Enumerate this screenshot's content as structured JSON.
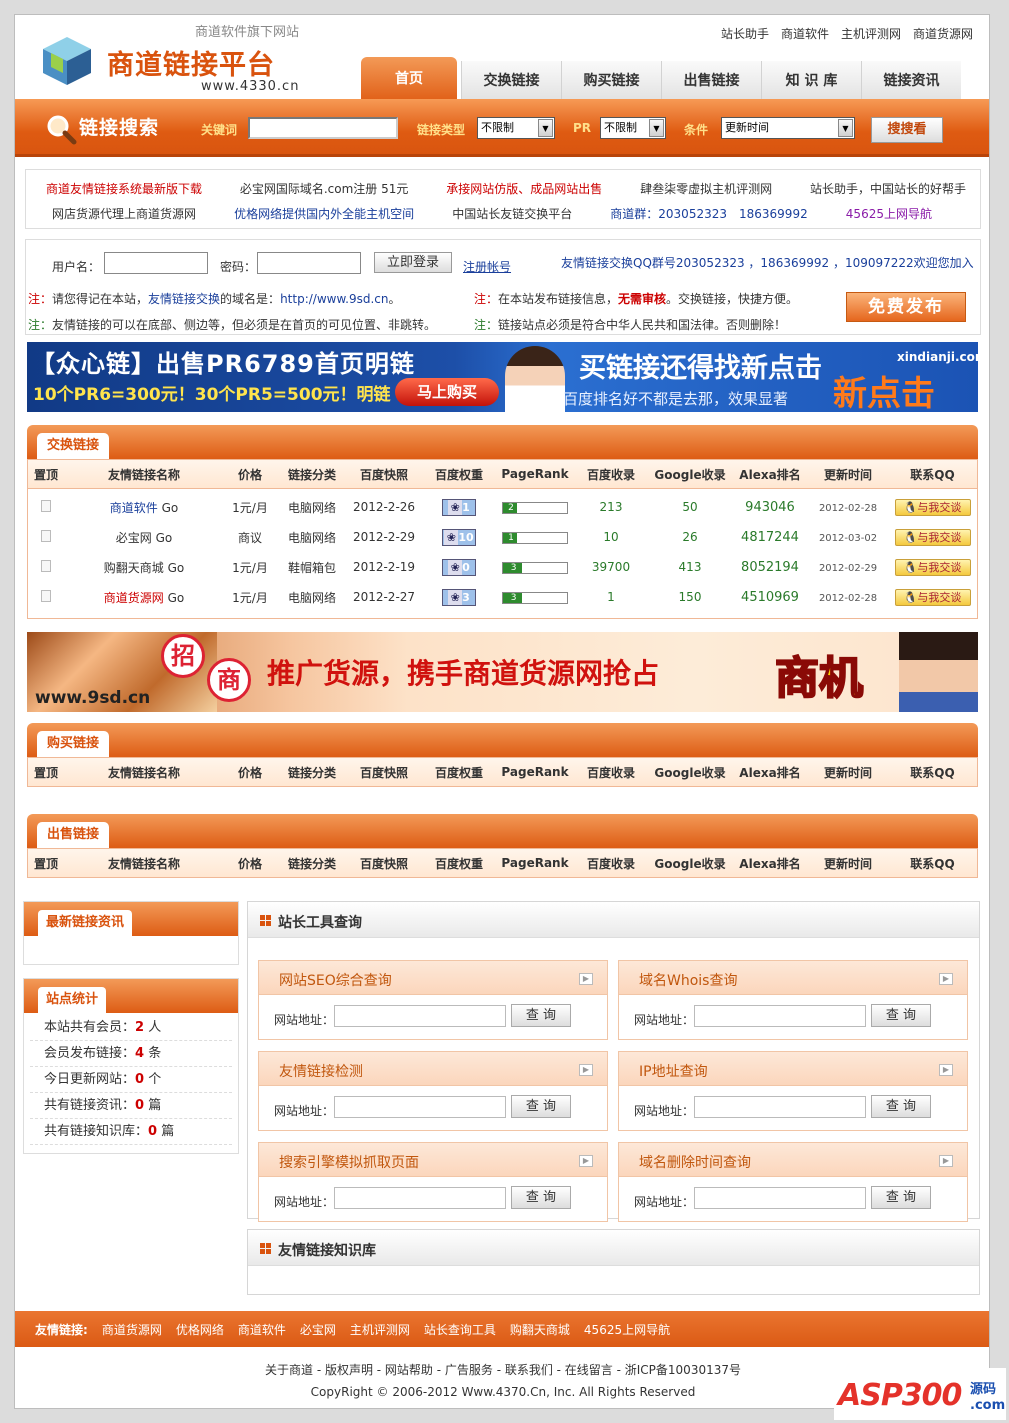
{
  "header": {
    "tagline": "商道软件旗下网站",
    "logo_title": "商道链接平台",
    "logo_url": "www.4330.cn",
    "toplinks": [
      "站长助手",
      "商道软件",
      "主机评测网",
      "商道货源网"
    ],
    "nav": [
      "首页",
      "交换链接",
      "购买链接",
      "出售链接",
      "知 识 库",
      "链接资讯"
    ]
  },
  "search": {
    "title": "链接搜索",
    "keyword_label": "关键词",
    "type_label": "链接类型",
    "type_value": "不限制",
    "pr_label": "PR",
    "pr_value": "不限制",
    "cond_label": "条件",
    "cond_value": "更新时间",
    "button": "搜搜看"
  },
  "ads": {
    "row1": [
      {
        "t": "商道友情链接系统最新版下载",
        "c": "#c00"
      },
      {
        "t": "必宝网国际域名.com注册 51元",
        "c": "#333"
      },
      {
        "t": "承接网站仿版、成品网站出售",
        "c": "#c00"
      },
      {
        "t": "肆叁柒零虚拟主机评测网",
        "c": "#333"
      },
      {
        "t": "站长助手，中国站长的好帮手",
        "c": "#333"
      }
    ],
    "row2": [
      {
        "t": "网店货源代理上商道货源网",
        "c": "#333"
      },
      {
        "t": "优格网络提供国内外全能主机空间",
        "c": "#1a3f9b"
      },
      {
        "t": "中国站长友链交换平台",
        "c": "#333"
      },
      {
        "t": "商道群：203052323　186369992",
        "c": "#1a3f9b"
      },
      {
        "t": "45625上网导航",
        "c": "#8a1ba8"
      }
    ]
  },
  "login": {
    "user_label": "用户名：",
    "pass_label": "密码：",
    "login_btn": "立即登录",
    "register": "注册帐号",
    "qq_groups": "友情链接交换QQ群号203052323 ，186369992 ，109097222欢迎您加入",
    "note1a": "注：",
    "note1b": "请您得记在本站，",
    "note1c": "友情链接交换",
    "note1d": "的域名是：",
    "note1e": "http://www.9sd.cn",
    "note1f": "。",
    "note2a": "注：",
    "note2b": "在本站发布链接信息，",
    "note2c": "无需审核",
    "note2d": "。交换链接，快捷方便。",
    "note3a": "注：",
    "note3b": "友情链接的可以在底部、侧边等，但必须是在首页的可见位置、非跳转。",
    "note4a": "注：",
    "note4b": "链接站点必须是符合中华人民共和国法律。否则删除！",
    "free_btn": "免费发布"
  },
  "banner1": {
    "left_title": "【众心链】出售PR6789首页明链",
    "left_sub": "10个PR6=300元！30个PR5=500元！明链",
    "buy_btn": "马上购买",
    "right_title": "买链接还得找新点击",
    "right_sub": "百度排名好不都是去那，效果显著",
    "right_site": "xindianji.com",
    "right_brand": "新点击"
  },
  "banner2": {
    "site": "www.9sd.cn",
    "zhao": "招",
    "shang": "商",
    "slogan1": "推广货源，携手商道货源网抢占",
    "slogan2": "商机"
  },
  "table_headers": [
    "置顶",
    "友情链接名称",
    "价格",
    "链接分类",
    "百度快照",
    "百度权重",
    "PageRank",
    "百度收录",
    "Google收录",
    "Alexa排名",
    "更新时间",
    "联系QQ"
  ],
  "exchange": {
    "title": "交换链接",
    "rows": [
      {
        "name": "商道软件",
        "go": "Go",
        "color": "#1a3f9b",
        "price": "1元/月",
        "cat": "电脑网络",
        "snap": "2012-2-26",
        "bw": "1",
        "pr": "2",
        "prpct": 0.2,
        "bd": "213",
        "gg": "50",
        "alexa": "943046",
        "upd": "2012-02-28",
        "qq": "与我交谈"
      },
      {
        "name": "必宝网",
        "go": "Go",
        "color": "#333",
        "price": "商议",
        "cat": "电脑网络",
        "snap": "2012-2-29",
        "bw": "10",
        "pr": "1",
        "prpct": 0.1,
        "bd": "10",
        "gg": "26",
        "alexa": "4817244",
        "upd": "2012-03-02",
        "qq": "与我交谈"
      },
      {
        "name": "购翻天商城",
        "go": "Go",
        "color": "#333",
        "price": "1元/月",
        "cat": "鞋帽箱包",
        "snap": "2012-2-19",
        "bw": "0",
        "pr": "3",
        "prpct": 0.3,
        "bd": "39700",
        "gg": "413",
        "alexa": "8052194",
        "upd": "2012-02-29",
        "qq": "与我交谈"
      },
      {
        "name": "商道货源网",
        "go": "Go",
        "color": "#c00",
        "price": "1元/月",
        "cat": "电脑网络",
        "snap": "2012-2-27",
        "bw": "3",
        "pr": "3",
        "prpct": 0.3,
        "bd": "1",
        "gg": "150",
        "alexa": "4510969",
        "upd": "2012-02-28",
        "qq": "与我交谈"
      }
    ]
  },
  "buy": {
    "title": "购买链接"
  },
  "sell": {
    "title": "出售链接"
  },
  "sidebar": {
    "news_title": "最新链接资讯",
    "stats_title": "站点统计",
    "stats": [
      {
        "l": "本站共有会员：",
        "v": "2",
        "u": " 人"
      },
      {
        "l": "会员发布链接：",
        "v": "4",
        "u": " 条"
      },
      {
        "l": "今日更新网站：",
        "v": "0",
        "u": " 个"
      },
      {
        "l": "共有链接资讯：",
        "v": "0",
        "u": " 篇"
      },
      {
        "l": "共有链接知识库：",
        "v": "0",
        "u": " 篇"
      }
    ]
  },
  "tools": {
    "title": "站长工具查询",
    "url_label": "网站地址：",
    "query": "查 询",
    "items": [
      "网站SEO综合查询",
      "域名Whois查询",
      "友情链接检测",
      "IP地址查询",
      "搜索引擎模拟抓取页面",
      "域名删除时间查询"
    ]
  },
  "kb": {
    "title": "友情链接知识库"
  },
  "footer": {
    "label": "友情链接:",
    "links": [
      "商道货源网",
      "优格网络",
      "商道软件",
      "必宝网",
      "主机评测网",
      "站长查询工具",
      "购翻天商城",
      "45625上网导航"
    ],
    "bottom_links": "关于商道 - 版权声明 - 网站帮助 - 广告服务 - 联系我们 - 在线留言 - 浙ICP备10030137号",
    "copyright": "CopyRight © 2006-2012 Www.4370.Cn, Inc. All Rights Reserved"
  },
  "watermark": {
    "brand": "ASP300",
    "sub": "源码",
    "url": ".com"
  }
}
